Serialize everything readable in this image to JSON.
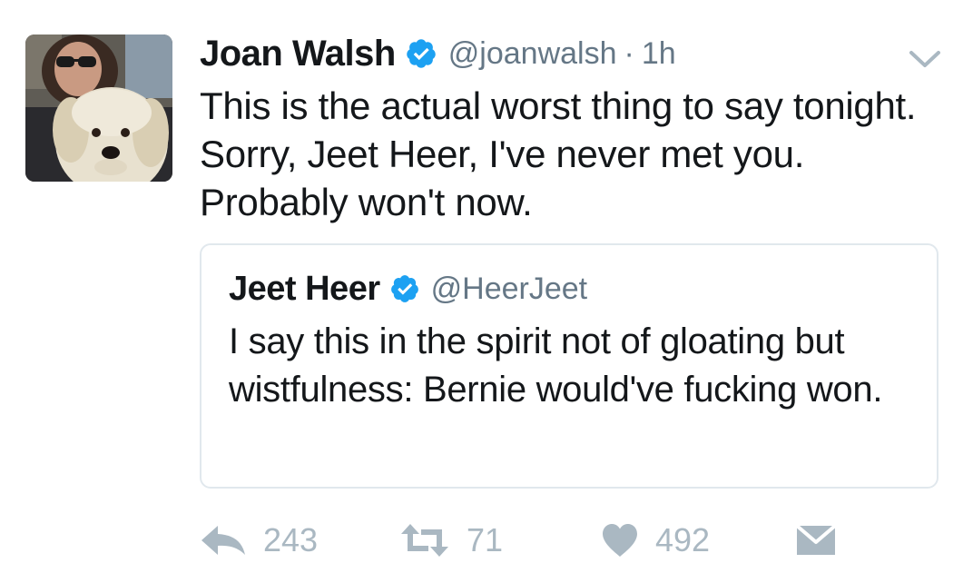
{
  "tweet": {
    "author": {
      "name": "Joan Walsh",
      "handle": "@joanwalsh",
      "verified": true,
      "avatar_icon": "avatar-woman-with-dog"
    },
    "separator": "·",
    "time": "1h",
    "text": "This is the actual worst thing to say tonight. Sorry, Jeet Heer, I've never met you. Probably won't now.",
    "menu_icon": "chevron-down-icon"
  },
  "quoted_tweet": {
    "author": {
      "name": "Jeet Heer",
      "handle": "@HeerJeet",
      "verified": true
    },
    "text": "I say this in the spirit not of gloating but wistfulness: Bernie would've fucking won."
  },
  "actions": {
    "reply_count": "243",
    "retweet_count": "71",
    "like_count": "492",
    "icons": [
      "reply-icon",
      "retweet-icon",
      "heart-icon",
      "direct-message-icon"
    ]
  },
  "colors": {
    "verified": "#1da1f2",
    "text": "#14171a",
    "muted": "#657786",
    "action": "#aab8c2",
    "border": "#e1e8ed"
  }
}
